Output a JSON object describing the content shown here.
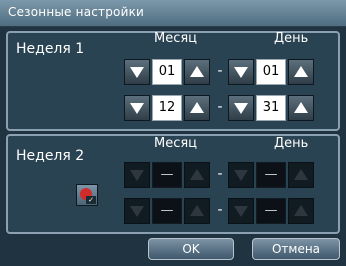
{
  "window": {
    "title": "Сезонные настройки"
  },
  "week1": {
    "label": "Неделя 1",
    "month_header": "Месяц",
    "day_header": "День",
    "start": {
      "month": "01",
      "day": "01"
    },
    "end": {
      "month": "12",
      "day": "31"
    },
    "separator": "-"
  },
  "week2": {
    "label": "Неделя 2",
    "month_header": "Месяц",
    "day_header": "День",
    "start": {
      "month": "—",
      "day": "—"
    },
    "end": {
      "month": "—",
      "day": "—"
    },
    "separator": "-",
    "enabled": false,
    "toggle_icon": "red-circle-toggle-icon"
  },
  "buttons": {
    "ok": "OK",
    "cancel": "Отмена"
  },
  "colors": {
    "title_bar": "#6d8a9c",
    "panel_bg": "#2a4352",
    "background": "#1f3340"
  }
}
